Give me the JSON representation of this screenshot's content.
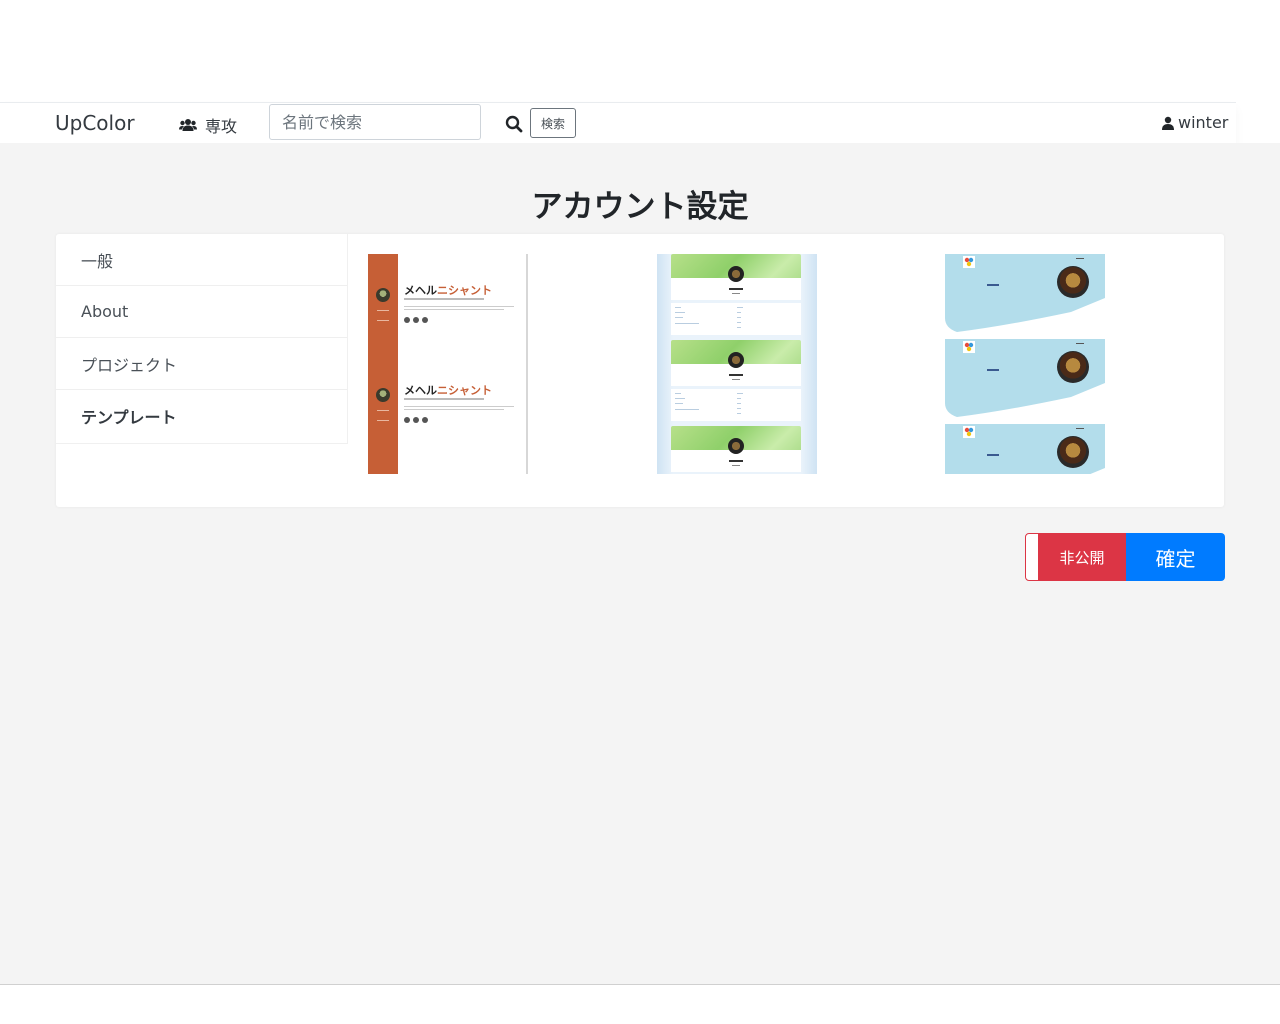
{
  "navbar": {
    "brand": "UpColor",
    "major_label": "専攻",
    "search_placeholder": "名前で検索",
    "search_button": "検索",
    "user_name": "winter"
  },
  "page": {
    "title": "アカウント設定"
  },
  "menu": {
    "items": [
      {
        "label": "一般"
      },
      {
        "label": "About"
      },
      {
        "label": "プロジェクト"
      },
      {
        "label": "テンプレート"
      }
    ]
  },
  "templates": {
    "template1": {
      "name_black": "メヘル",
      "name_accent": "ニシャント"
    }
  },
  "actions": {
    "private_label": "非公開",
    "confirm_label": "確定"
  },
  "colors": {
    "brand_blue": "#007bff",
    "danger_red": "#dc3545",
    "template1_accent": "#c65f36",
    "template3_wave": "#b3ddeb"
  }
}
